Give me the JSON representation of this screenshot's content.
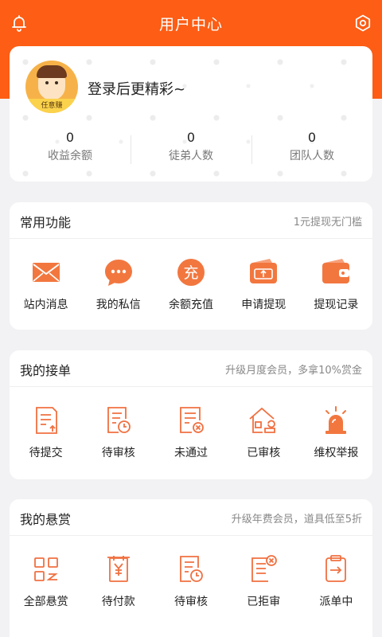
{
  "colors": {
    "brand": "#fd5d14",
    "icon": "#f07040",
    "icon_fill": "#f2773f"
  },
  "header": {
    "title": "用户中心",
    "left_icon": "bell-icon",
    "right_icon": "settings-icon"
  },
  "profile": {
    "avatar_tag": "任意赚",
    "login_prompt": "登录后更精彩~",
    "stats": [
      {
        "value": "0",
        "label": "收益余额"
      },
      {
        "value": "0",
        "label": "徒弟人数"
      },
      {
        "value": "0",
        "label": "团队人数"
      }
    ]
  },
  "common": {
    "title": "常用功能",
    "note": "1元提现无门槛",
    "items": [
      {
        "label": "站内消息",
        "icon": "mail-icon"
      },
      {
        "label": "我的私信",
        "icon": "chat-bubble-icon"
      },
      {
        "label": "余额充值",
        "icon": "recharge-icon",
        "glyph": "充"
      },
      {
        "label": "申请提现",
        "icon": "wallet-upload-icon"
      },
      {
        "label": "提现记录",
        "icon": "wallet-icon"
      }
    ]
  },
  "orders": {
    "title": "我的接单",
    "note": "升级月度会员，多拿10%赏金",
    "items": [
      {
        "label": "待提交",
        "icon": "document-upload-icon"
      },
      {
        "label": "待审核",
        "icon": "document-clock-icon"
      },
      {
        "label": "未通过",
        "icon": "document-reject-icon"
      },
      {
        "label": "已审核",
        "icon": "house-stamp-icon"
      },
      {
        "label": "维权举报",
        "icon": "alarm-light-icon"
      }
    ]
  },
  "reward": {
    "title": "我的悬赏",
    "note": "升级年费会员，道具低至5折",
    "items": [
      {
        "label": "全部悬赏",
        "icon": "grid-icon"
      },
      {
        "label": "待付款",
        "icon": "yuan-document-icon"
      },
      {
        "label": "待审核",
        "icon": "document-clock-icon"
      },
      {
        "label": "已拒审",
        "icon": "document-rejected-icon"
      },
      {
        "label": "派单中",
        "icon": "clipboard-arrow-icon"
      }
    ]
  }
}
